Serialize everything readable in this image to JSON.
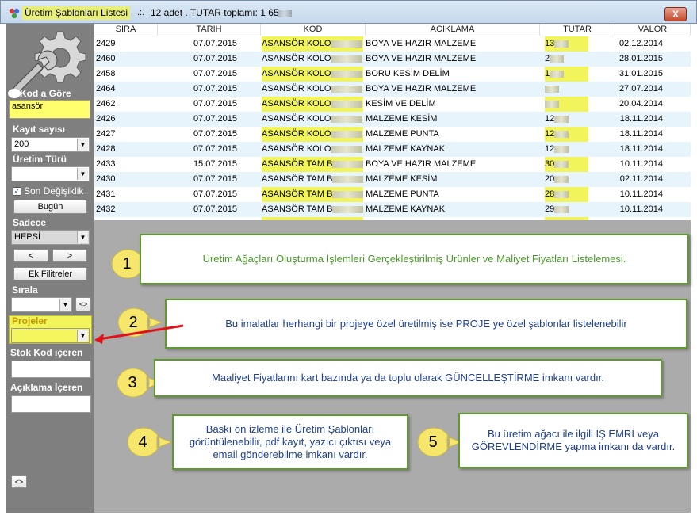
{
  "window": {
    "title": "Üretim Şablonları Listesi",
    "separator": ".:.",
    "summary": "12 adet . TUTAR toplamı: 1 65",
    "close_label": "X"
  },
  "sidebar": {
    "kod_label": "Kod a Göre",
    "kod_value": "asansör",
    "kayit_label": "Kayıt sayısı",
    "kayit_value": "200",
    "uretim_turu_label": "Üretim Türü",
    "uretim_turu_value": "",
    "son_degisiklik_label": "Son Değişiklik",
    "bugun_button": "Bugün",
    "sadece_label": "Sadece",
    "sadece_value": "HEPSİ",
    "prev_button": "<",
    "next_button": ">",
    "ek_filtreler_button": "Ek Filitreler",
    "sirala_label": "Sırala",
    "sirala_value": "",
    "sirala_toggle": "<>",
    "projeler_label": "Projeler",
    "projeler_value": "",
    "stok_kod_label": "Stok Kod içeren",
    "stok_kod_value": "",
    "aciklama_label": "Açıklama İçeren",
    "aciklama_value": "",
    "bottom_toggle": "<>"
  },
  "grid": {
    "columns": [
      "SIRA",
      "TARIH",
      "KOD",
      "ACIKLAMA",
      "TUTAR",
      "VALOR"
    ],
    "rows": [
      {
        "sira": "2429",
        "tarih": "07.07.2015",
        "kod": "ASANSÖR KOLO",
        "aciklama": "BOYA VE HAZIR MALZEME",
        "tutar": "13",
        "valor": "02.12.2014"
      },
      {
        "sira": "2460",
        "tarih": "07.07.2015",
        "kod": "ASANSÖR KOLO",
        "aciklama": "BOYA VE HAZIR MALZEME",
        "tutar": "2",
        "valor": "28.01.2015"
      },
      {
        "sira": "2458",
        "tarih": "07.07.2015",
        "kod": "ASANSÖR KOLO",
        "aciklama": "BORU KESİM DELİM",
        "tutar": "1",
        "valor": "31.01.2015"
      },
      {
        "sira": "2464",
        "tarih": "07.07.2015",
        "kod": "ASANSÖR KOLO",
        "aciklama": "BOYA VE HAZIR MALZEME",
        "tutar": "",
        "valor": "27.07.2014"
      },
      {
        "sira": "2462",
        "tarih": "07.07.2015",
        "kod": "ASANSÖR KOLO",
        "aciklama": "KESİM VE DELİM",
        "tutar": "",
        "valor": "20.04.2014"
      },
      {
        "sira": "2426",
        "tarih": "07.07.2015",
        "kod": "ASANSÖR KOLO",
        "aciklama": "MALZEME KESİM",
        "tutar": "12",
        "valor": "18.11.2014"
      },
      {
        "sira": "2427",
        "tarih": "07.07.2015",
        "kod": "ASANSÖR KOLO",
        "aciklama": "MALZEME PUNTA",
        "tutar": "12",
        "valor": "18.11.2014"
      },
      {
        "sira": "2428",
        "tarih": "07.07.2015",
        "kod": "ASANSÖR KOLO",
        "aciklama": "MALZEME KAYNAK",
        "tutar": "12",
        "valor": "18.11.2014"
      },
      {
        "sira": "2433",
        "tarih": "15.07.2015",
        "kod": "ASANSÖR TAM B",
        "aciklama": "BOYA VE HAZIR MALZEME",
        "tutar": "30",
        "valor": "10.11.2014"
      },
      {
        "sira": "2430",
        "tarih": "07.07.2015",
        "kod": "ASANSÖR TAM B",
        "aciklama": "MALZEME KESİM",
        "tutar": "20",
        "valor": "02.11.2014"
      },
      {
        "sira": "2431",
        "tarih": "07.07.2015",
        "kod": "ASANSÖR TAM B",
        "aciklama": "MALZEME PUNTA",
        "tutar": "28",
        "valor": "10.11.2014"
      },
      {
        "sira": "2432",
        "tarih": "07.07.2015",
        "kod": "ASANSÖR TAM B",
        "aciklama": "MALZEME KAYNAK",
        "tutar": "29",
        "valor": "10.11.2014"
      }
    ]
  },
  "callouts": [
    {
      "number": "1",
      "text": "Üretim Ağaçları Oluşturma İşlemleri Gerçekleştirilmiş Ürünler ve Maliyet Fiyatları Listelemesi."
    },
    {
      "number": "2",
      "text": "Bu imalatlar herhangi bir projeye özel üretilmiş ise PROJE ye özel şablonlar listelenebilir"
    },
    {
      "number": "3",
      "text": "Maaliyet Fiyatlarını kart bazında ya da toplu olarak GÜNCELLEŞTİRME imkanı vardır."
    },
    {
      "number": "4",
      "text": "Baskı ön izleme ile  Üretim Şablonları görüntülenebilir, pdf kayıt, yazıcı çıktısı veya email gönderebilme imkanı vardır."
    },
    {
      "number": "5",
      "text": "Bu üretim ağacı ile ilgili İŞ EMRİ veya GÖREVLENDİRME yapma imkanı da vardır."
    }
  ],
  "colors": {
    "highlight": "#f2f45c",
    "callout_border": "#5f9a2f",
    "callout_text": "#1f3f8f",
    "bubble_fill": "#f6e66b",
    "arrow": "#e0121a"
  }
}
